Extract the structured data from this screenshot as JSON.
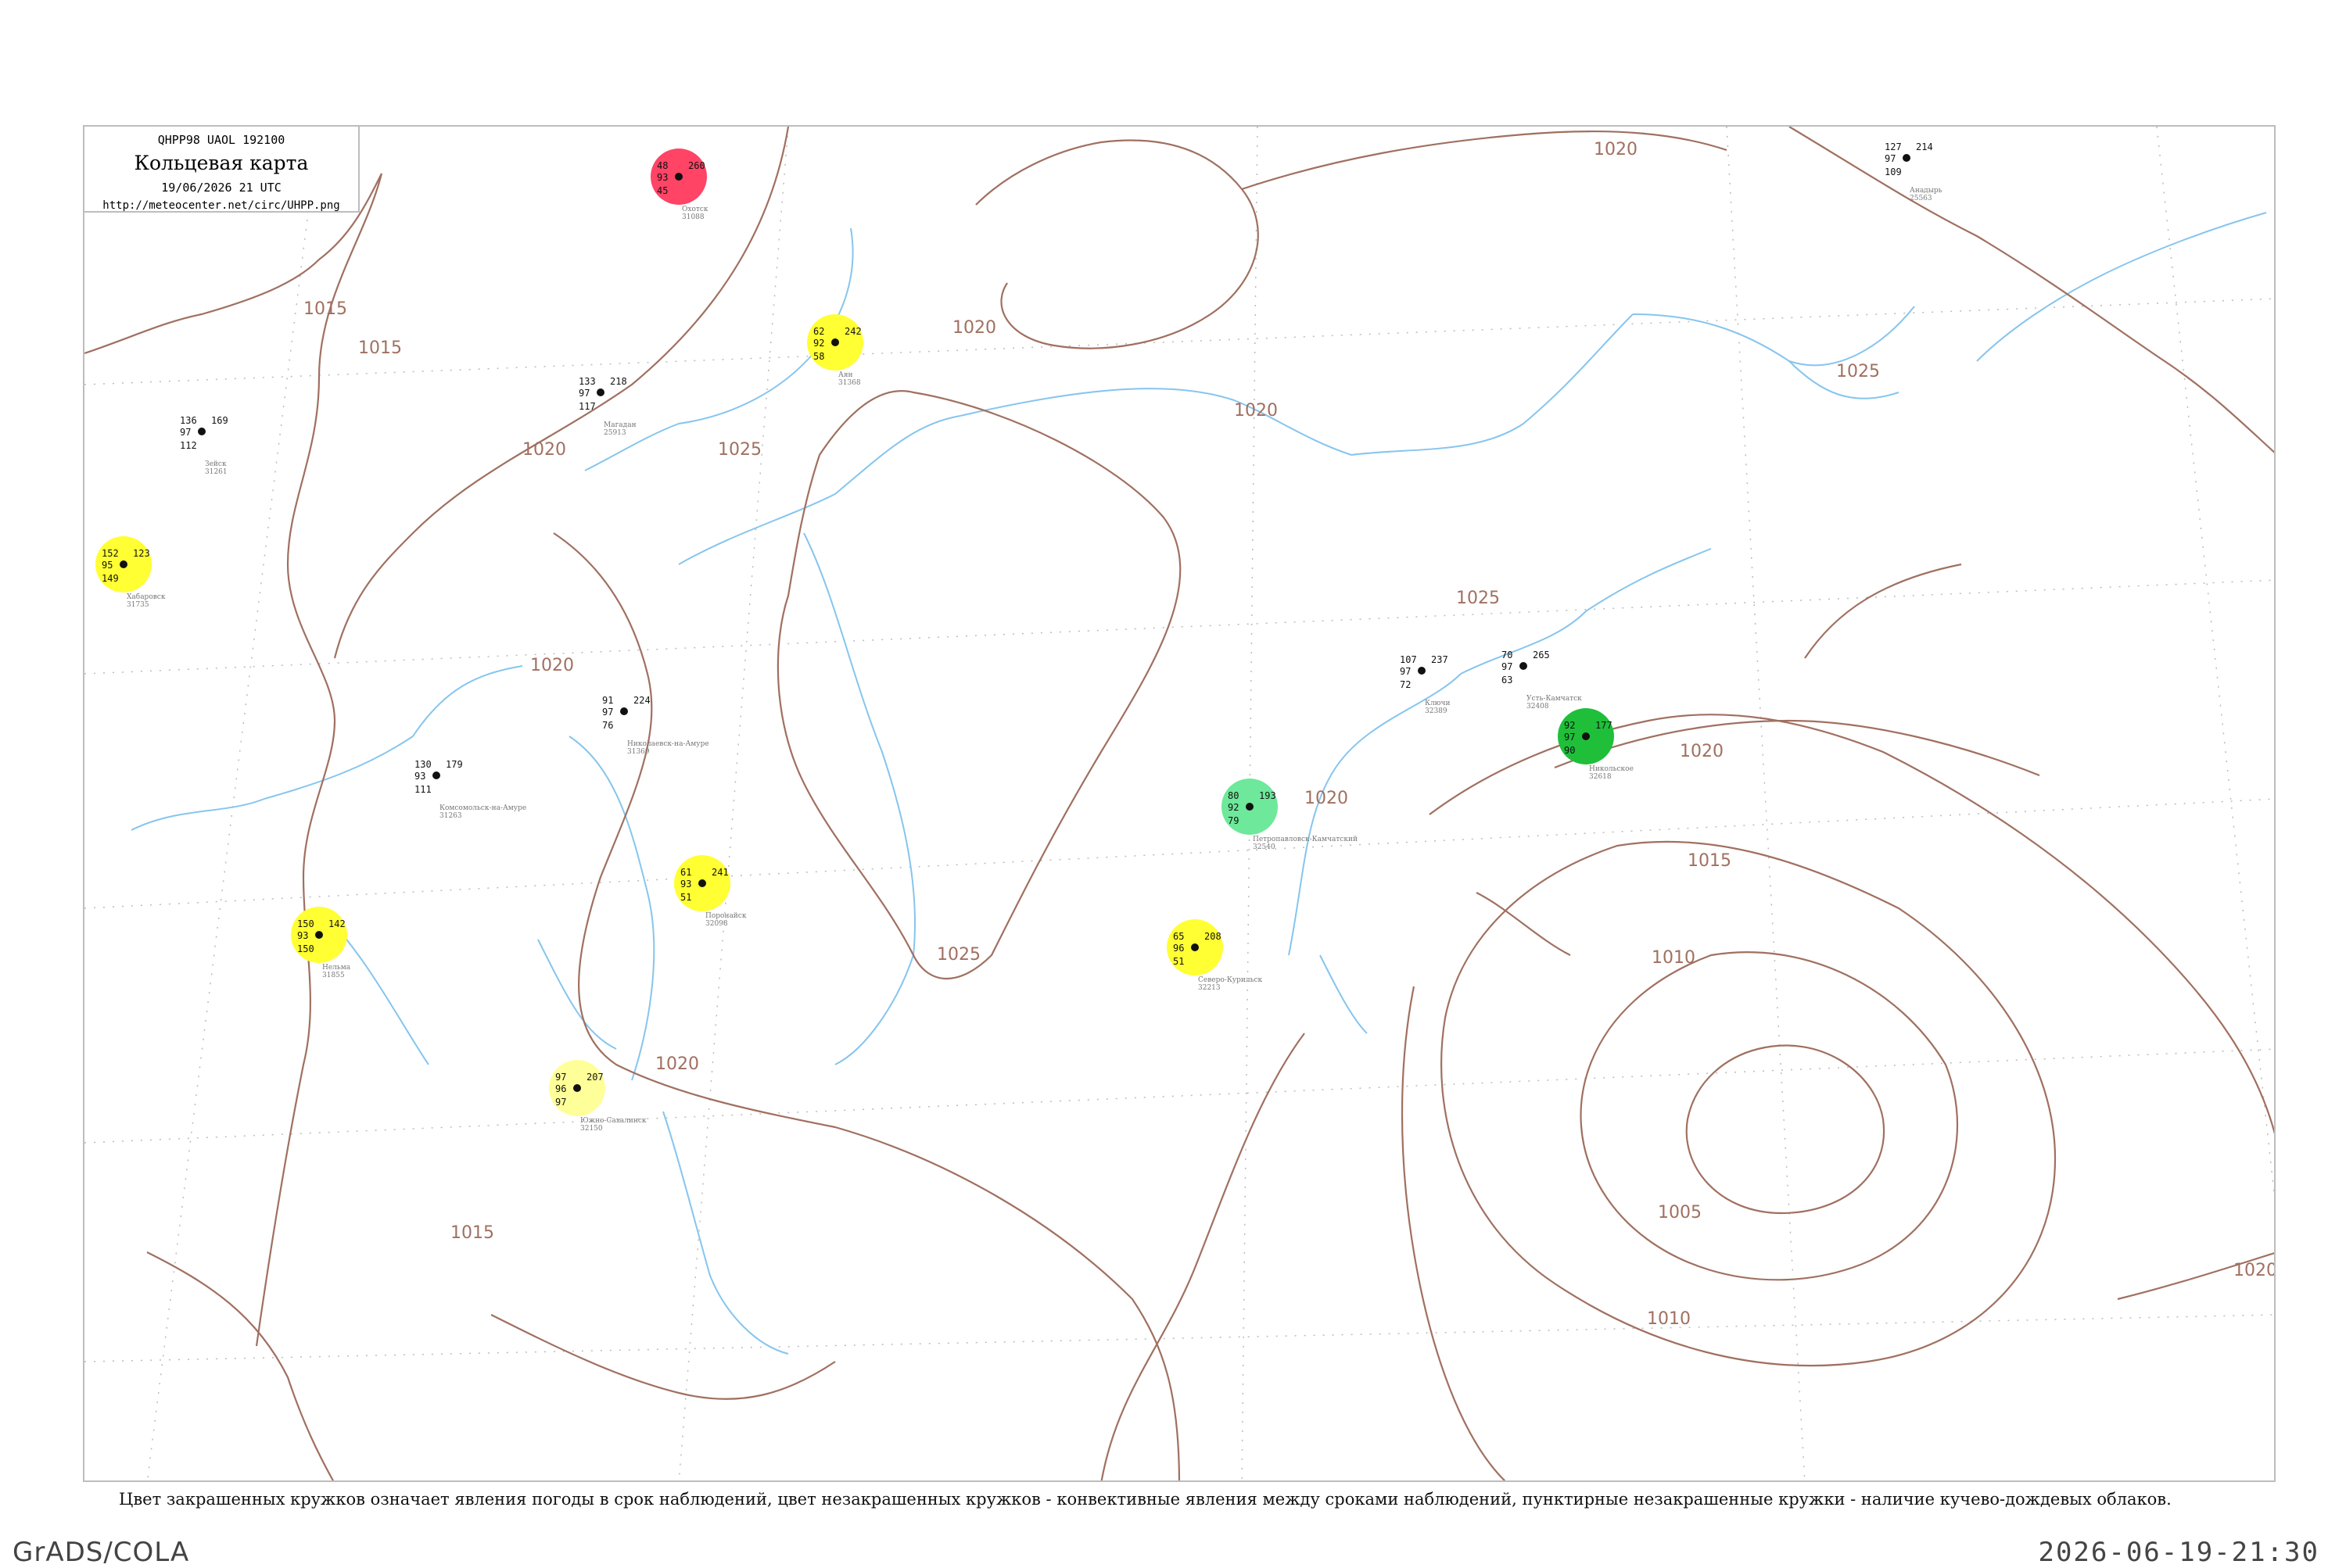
{
  "header": {
    "code": "QHPP98  UAOL  192100",
    "title": "Кольцевая карта",
    "datetime": "19/06/2026 21 UTC",
    "url": "http://meteocenter.net/circ/UHPP.png"
  },
  "caption": "Цвет закрашенных кружков означает явления погоды в срок наблюдений, цвет незакрашенных кружков - конвективные явления между сроками наблюдений, пунктирные незакрашенные кружки - наличие кучево-дождевых облаков.",
  "footer": {
    "left": "GrADS/COLA",
    "right": "2026-06-19-21:30"
  },
  "colors": {
    "heavy_green": "#1fbf3a",
    "medium_green": "#6ee89a",
    "yellow": "#ffff33",
    "light_yellow": "#ffff99",
    "red": "#ff4466",
    "isobar": "#a07060",
    "river": "#86c5ee",
    "dashed_circle": "#22aa33"
  },
  "isobar_labels": [
    {
      "text": "1015"
    },
    {
      "text": "1015"
    },
    {
      "text": "1020"
    },
    {
      "text": "1025"
    },
    {
      "text": "1020"
    },
    {
      "text": "1020"
    },
    {
      "text": "1025"
    },
    {
      "text": "1020"
    },
    {
      "text": "1025"
    },
    {
      "text": "1020"
    },
    {
      "text": "1020"
    },
    {
      "text": "1015"
    },
    {
      "text": "1010"
    },
    {
      "text": "1005"
    },
    {
      "text": "1010"
    },
    {
      "text": "1015"
    },
    {
      "text": "1020"
    },
    {
      "text": "1020"
    },
    {
      "text": "1025"
    },
    {
      "text": "1020"
    }
  ],
  "stations": [
    {
      "name": "Хабаровск",
      "id": "31735",
      "temp": "152",
      "dew": "149",
      "p": "123",
      "t2": "95",
      "style": "yellow"
    },
    {
      "name": "Аян",
      "id": "31368",
      "temp": "62",
      "dew": "58",
      "p": "242",
      "t2": "92",
      "style": "yellow"
    },
    {
      "name": "Охотск",
      "id": "31088",
      "temp": "48",
      "dew": "45",
      "p": "260",
      "t2": "93",
      "style": "red"
    },
    {
      "name": "Нельма",
      "id": "31855",
      "temp": "150",
      "dew": "150",
      "p": "142",
      "t2": "93",
      "style": "yellow"
    },
    {
      "name": "Магадан",
      "id": "25913",
      "temp": "133",
      "dew": "117",
      "p": "218",
      "t2": "97",
      "style": "none"
    },
    {
      "name": "Комсомольск-на-Амуре",
      "id": "31263",
      "temp": "130",
      "dew": "111",
      "p": "179",
      "t2": "93",
      "style": "none"
    },
    {
      "name": "Николаевск-на-Амуре",
      "id": "31369",
      "temp": "91",
      "dew": "76",
      "p": "224",
      "t2": "97",
      "style": "none"
    },
    {
      "name": "Поронайск",
      "id": "32098",
      "temp": "61",
      "dew": "51",
      "p": "241",
      "t2": "93",
      "style": "yellow"
    },
    {
      "name": "Южно-Сахалинск",
      "id": "32150",
      "temp": "97",
      "dew": "97",
      "p": "207",
      "t2": "96",
      "style": "light_yellow"
    },
    {
      "name": "Петропавловск-Камчатский",
      "id": "32540",
      "temp": "80",
      "dew": "79",
      "p": "193",
      "t2": "92",
      "style": "medium_green"
    },
    {
      "name": "Усть-Камчатск",
      "id": "32408",
      "temp": "70",
      "dew": "63",
      "p": "265",
      "t2": "97",
      "style": "none"
    },
    {
      "name": "Ключи",
      "id": "32389",
      "temp": "107",
      "dew": "72",
      "p": "237",
      "t2": "97",
      "style": "none"
    },
    {
      "name": "Никольское",
      "id": "32618",
      "temp": "92",
      "dew": "90",
      "p": "177",
      "t2": "97",
      "style": "heavy_green"
    },
    {
      "name": "Северо-Курильск",
      "id": "32213",
      "temp": "65",
      "dew": "51",
      "p": "208",
      "t2": "96",
      "style": "yellow"
    },
    {
      "name": "Зейск",
      "id": "31261",
      "temp": "136",
      "dew": "112",
      "p": "169",
      "t2": "97",
      "style": "none"
    },
    {
      "name": "Анадырь",
      "id": "25563",
      "temp": "127",
      "dew": "109",
      "p": "214",
      "t2": "97",
      "style": "none"
    }
  ]
}
